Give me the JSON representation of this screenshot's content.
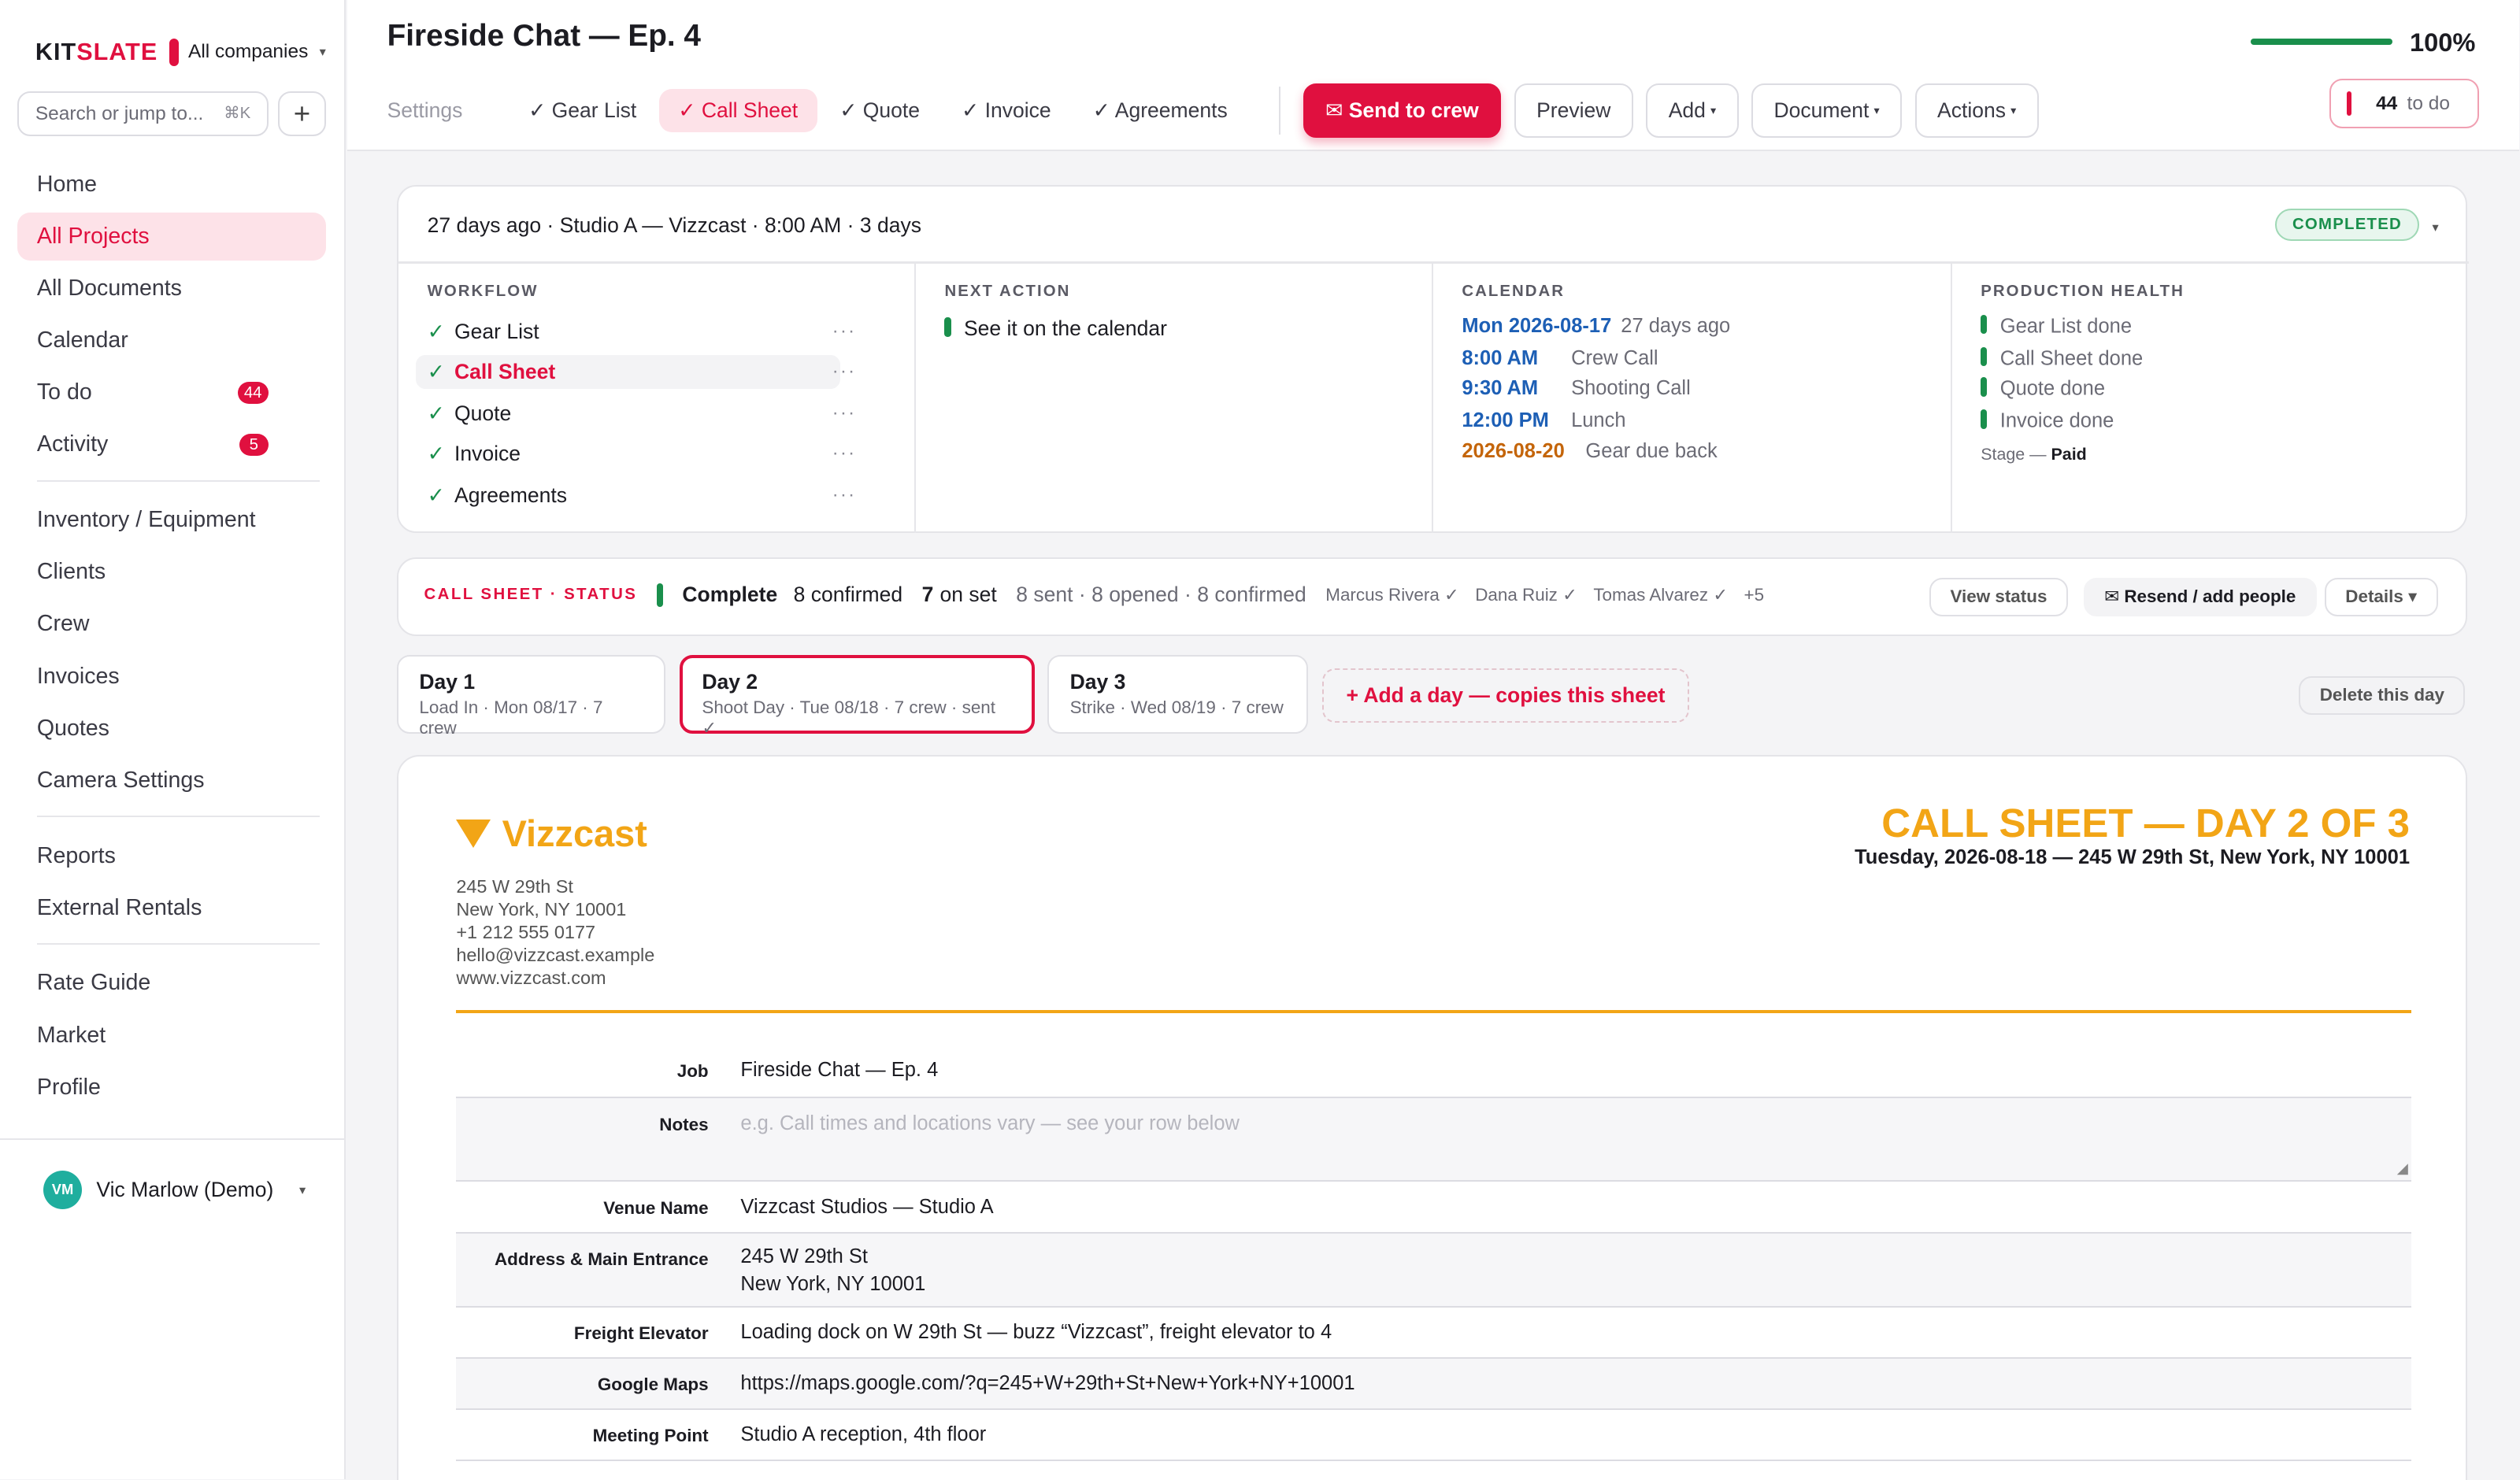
{
  "sidebar": {
    "brand_kit": "KIT",
    "brand_slate": "SLATE",
    "company": "All companies",
    "search_placeholder": "Search or jump to...",
    "search_shortcut": "⌘K",
    "add_label": "+",
    "items": [
      {
        "label": "Home"
      },
      {
        "label": "All Projects",
        "active": true
      },
      {
        "label": "All Documents"
      },
      {
        "label": "Calendar"
      },
      {
        "label": "To do",
        "badge": "44"
      },
      {
        "label": "Activity",
        "badge": "5"
      },
      {
        "label": "Inventory / Equipment"
      },
      {
        "label": "Clients"
      },
      {
        "label": "Crew"
      },
      {
        "label": "Invoices"
      },
      {
        "label": "Quotes"
      },
      {
        "label": "Camera Settings"
      },
      {
        "label": "Reports"
      },
      {
        "label": "External Rentals"
      },
      {
        "label": "Rate Guide"
      },
      {
        "label": "Market"
      },
      {
        "label": "Profile"
      }
    ],
    "user": {
      "initials": "VM",
      "name": "Vic Marlow (Demo)"
    }
  },
  "header": {
    "title": "Fireside Chat — Ep. 4",
    "progress_label": "100%",
    "progress_fraction": 1.0,
    "tabs": {
      "settings": "Settings",
      "gear_list": "✓ Gear List",
      "call_sheet": "✓ Call Sheet",
      "quote": "✓ Quote",
      "invoice": "✓ Invoice",
      "agreements": "✓ Agreements"
    },
    "send_to_crew": "✉ Send to crew",
    "preview": "Preview",
    "add": "Add",
    "document": "Document",
    "actions": "Actions",
    "todo_count": "44",
    "todo_label": "to do"
  },
  "overview": {
    "summary": "27 days ago · Studio A — Vizzcast · 8:00 AM · 3 days",
    "status": "COMPLETED",
    "workflow_title": "WORKFLOW",
    "workflow": [
      "Gear List",
      "Call Sheet",
      "Quote",
      "Invoice",
      "Agreements"
    ],
    "next_action_title": "NEXT ACTION",
    "next_action": "See it on the calendar",
    "calendar_title": "CALENDAR",
    "calendar": [
      {
        "time": "Mon 2026-08-17",
        "desc": "27 days ago"
      },
      {
        "time": "8:00 AM",
        "desc": "Crew Call"
      },
      {
        "time": "9:30 AM",
        "desc": "Shooting Call"
      },
      {
        "time": "12:00 PM",
        "desc": "Lunch"
      },
      {
        "time": "2026-08-20",
        "desc": "Gear due back"
      }
    ],
    "health_title": "PRODUCTION HEALTH",
    "health": [
      "Gear List done",
      "Call Sheet done",
      "Quote done",
      "Invoice done"
    ],
    "stage_label": "Stage —",
    "stage_value": "Paid"
  },
  "call_status": {
    "label": "CALL SHEET · STATUS",
    "state": "Complete",
    "confirmed": "8 confirmed",
    "on_set_num": "7",
    "on_set_txt": "on set",
    "sent_num": "8",
    "sent_txt": "sent ·",
    "opened_num": "8",
    "opened_txt": "opened ·",
    "confirmed2_num": "8",
    "confirmed2_txt": "confirmed",
    "people": [
      "Marcus Rivera ✓",
      "Dana Ruiz ✓",
      "Tomas Alvarez ✓",
      "+5"
    ],
    "view_status": "View status",
    "resend": "✉ Resend / add people",
    "details": "Details ▾"
  },
  "days": [
    {
      "title": "Day 1",
      "sub": "Load In · Mon 08/17 · 7 crew"
    },
    {
      "title": "Day 2",
      "sub": "Shoot Day · Tue 08/18 · 7 crew · sent ✓",
      "selected": true
    },
    {
      "title": "Day 3",
      "sub": "Strike · Wed 08/19 · 7 crew"
    }
  ],
  "add_day": "+ Add a day — copies this sheet",
  "delete_day": "Delete this day",
  "sheet": {
    "company": "Vizzcast",
    "address_lines": [
      "245 W 29th St",
      "New York, NY 10001",
      "+1 212 555 0177",
      "hello@vizzcast.example",
      "www.vizzcast.com"
    ],
    "title": "CALL SHEET — DAY 2 OF 3",
    "subtitle": "Tuesday, 2026-08-18 — 245 W 29th St, New York, NY 10001",
    "fields": {
      "job": {
        "label": "Job",
        "value": "Fireside Chat — Ep. 4"
      },
      "notes": {
        "label": "Notes",
        "placeholder": "e.g. Call times and locations vary — see your row below"
      },
      "venue": {
        "label": "Venue Name",
        "value": "Vizzcast Studios — Studio A"
      },
      "address": {
        "label": "Address & Main Entrance",
        "line1": "245 W 29th St",
        "line2": "New York, NY 10001"
      },
      "freight": {
        "label": "Freight Elevator",
        "value": "Loading dock on W 29th St — buzz “Vizzcast”, freight elevator to 4"
      },
      "maps": {
        "label": "Google Maps",
        "value": "https://maps.google.com/?q=245+W+29th+St+New+York+NY+10001"
      },
      "meeting": {
        "label": "Meeting Point",
        "value": "Studio A reception, 4th floor"
      }
    }
  }
}
